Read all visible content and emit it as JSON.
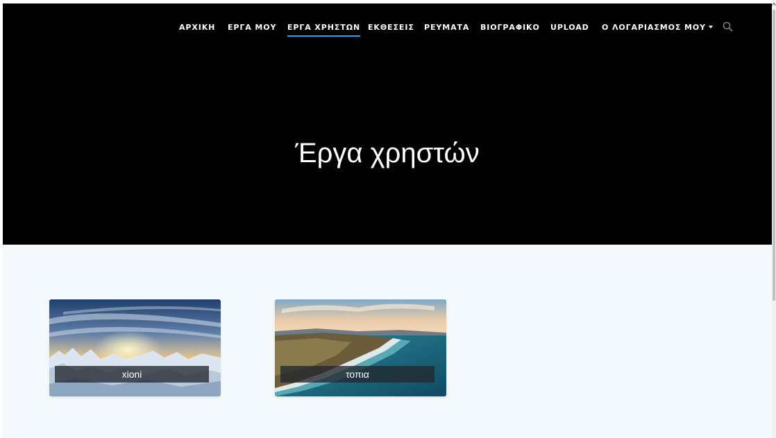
{
  "nav": {
    "items": [
      {
        "label": "ΑΡΧΙΚΗ",
        "active": false
      },
      {
        "label": "ΕΡΓΑ ΜΟΥ",
        "active": false
      },
      {
        "label": "ΕΡΓΑ ΧΡΗΣΤΩΝ",
        "active": true
      },
      {
        "label": "ΕΚΘΕΣΕΙΣ",
        "active": false
      },
      {
        "label": "ΡΕΥΜΑΤΑ",
        "active": false
      },
      {
        "label": "ΒΙΟΓΡΑΦΙΚΟ",
        "active": false
      },
      {
        "label": "UPLOAD",
        "active": false
      },
      {
        "label": "Ο ΛΟΓΑΡΙΑΣΜΟΣ ΜΟΥ",
        "active": false,
        "dropdown": true
      }
    ],
    "search_icon": "search-icon",
    "accent_color": "#2fa3e6"
  },
  "hero": {
    "title": "Έργα χρηστών"
  },
  "gallery": {
    "cards": [
      {
        "label": "xioni",
        "image": "snowy-forest-sunset"
      },
      {
        "label": "τοπια",
        "image": "coastline-aerial"
      }
    ]
  },
  "colors": {
    "navbar_bg": "#000000",
    "page_bg": "#f3f9fc",
    "accent": "#2fa3e6"
  }
}
